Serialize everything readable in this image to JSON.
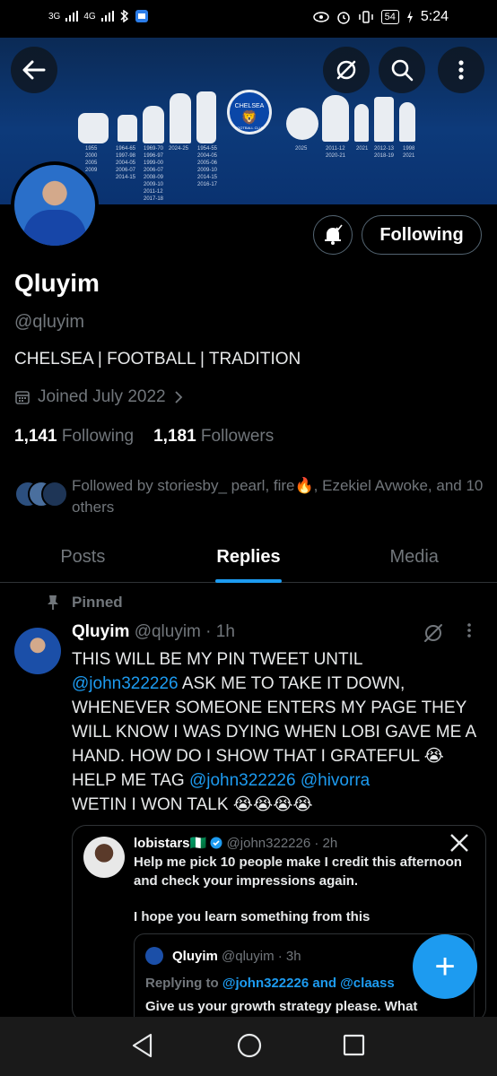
{
  "status_bar": {
    "network_left": "3G",
    "network_right": "4G",
    "battery": "54",
    "time": "5:24"
  },
  "header": {
    "back_icon": "arrow-left-icon",
    "grok_icon": "grok-icon",
    "search_icon": "search-icon",
    "more_icon": "more-vertical-icon"
  },
  "banner": {
    "club": "CHELSEA",
    "club_sub": "FOOTBALL CLUB",
    "years": [
      "1955\n2000\n2005\n2009",
      "1964-65\n1997-98\n2004-05\n2006-07\n2014-15",
      "1969-70\n1996-97\n1999-00\n2006-07\n2008-09\n2009-10\n2011-12\n2017-18",
      "2024-25",
      "1954-55\n2004-05\n2005-06\n2009-10\n2014-15\n2016-17",
      "2025",
      "2011-12\n2020-21",
      "2021",
      "2012-13\n2018-19",
      "1998\n2021"
    ]
  },
  "profile": {
    "display_name": "Qluyim",
    "handle": "@qluyim",
    "bio": "CHELSEA | FOOTBALL | TRADITION",
    "joined": "Joined July 2022",
    "following_count": "1,141",
    "following_label": "Following",
    "followers_count": "1,181",
    "followers_label": "Followers",
    "followed_by": "Followed by storiesby_ pearl, fire🔥, Ezekiel Avwoke, and 10 others",
    "follow_button": "Following"
  },
  "tabs": [
    {
      "label": "Posts"
    },
    {
      "label": "Replies"
    },
    {
      "label": "Media"
    }
  ],
  "tweet": {
    "pinned_label": "Pinned",
    "name": "Qluyim",
    "meta": "@qluyim · 1h",
    "line1": "THIS WILL BE MY PIN TWEET UNTIL",
    "mention1": "@john322226",
    "line2": " ASK ME TO TAKE IT DOWN, WHENEVER SOMEONE ENTERS MY PAGE THEY WILL KNOW I WAS DYING WHEN LOBI GAVE ME A HAND. HOW DO I SHOW THAT I GRATEFUL 😭",
    "line3": "HELP ME TAG ",
    "mention2": "@john322226",
    "mention3": "@hivorra",
    "line4": "WETIN I WON TALK 😭😭😭😭"
  },
  "quote": {
    "name": "lobistars🇳🇬",
    "meta": "@john322226 · 2h",
    "body": "Help me pick 10 people make I credit this afternoon and check your impressions again.",
    "body2": "I hope you learn something from this",
    "inner": {
      "name": "Qluyim",
      "meta": "@qluyim · 3h",
      "reply_prefix": "Replying to ",
      "reply_to": "@john322226 and @claass",
      "body": "Give us your growth strategy please. What"
    }
  },
  "fab_label": "+",
  "colors": {
    "accent": "#1d9bf0",
    "background": "#000000",
    "muted": "#71767b",
    "banner": "#0d3a7a"
  }
}
